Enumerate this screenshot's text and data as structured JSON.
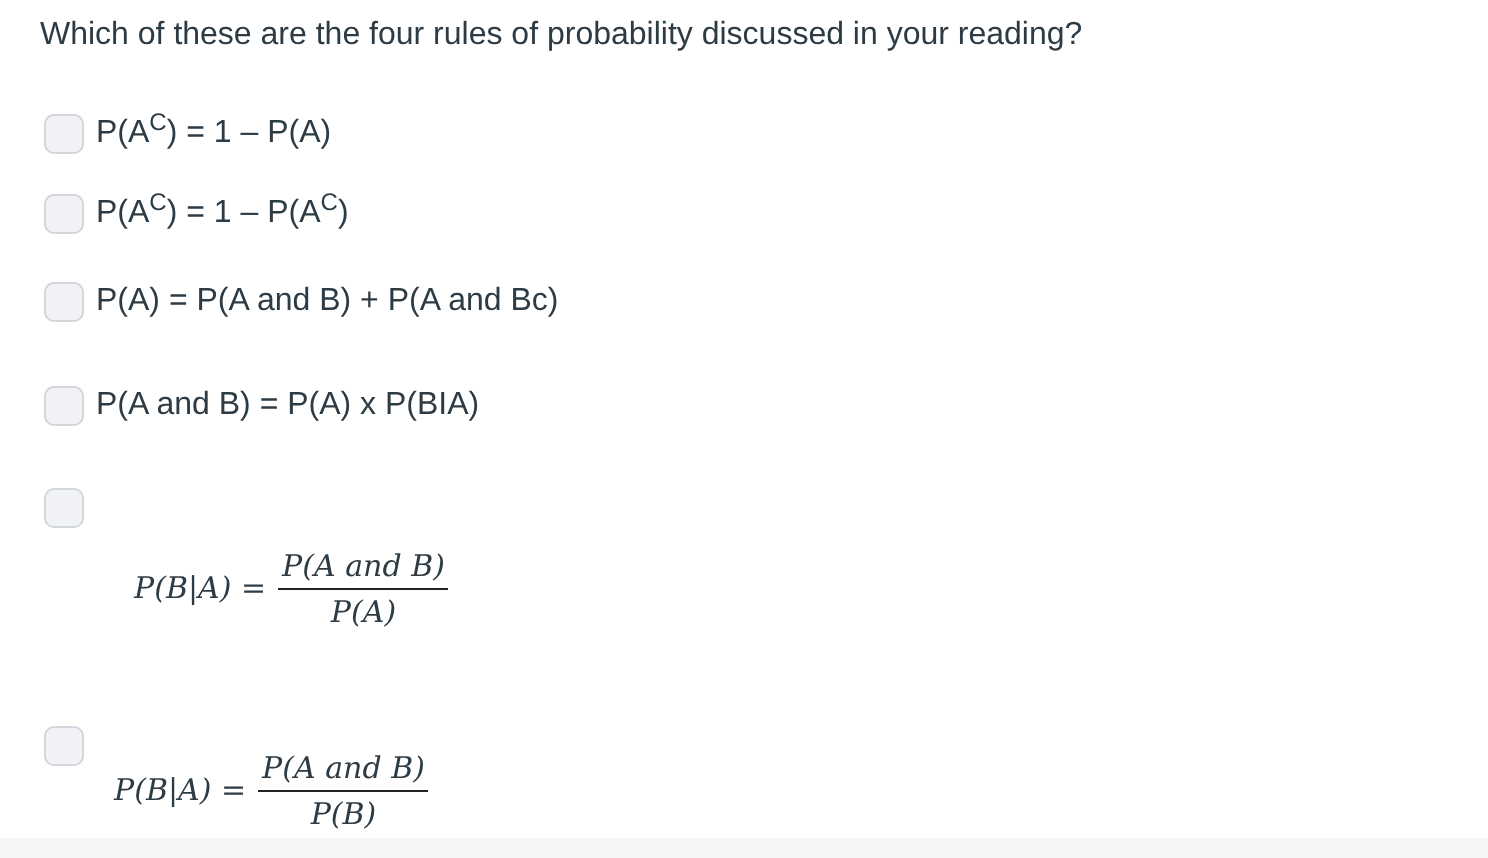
{
  "question": "Which of these are the four rules of probability discussed in your reading?",
  "options": [
    {
      "kind": "text",
      "checked": false,
      "text": "P(A$^{C}$) = 1 – P(A)"
    },
    {
      "kind": "text",
      "checked": false,
      "text": "P(A$^{C}$) = 1 – P(A$^{C}$)"
    },
    {
      "kind": "text",
      "checked": false,
      "text": "P(A) = P(A and B) + P(A and Bc)"
    },
    {
      "kind": "text",
      "checked": false,
      "text": "P(A and B) = P(A) x P(BIA)"
    },
    {
      "kind": "fraction",
      "checked": false,
      "lhs": "P(B|A) =",
      "numerator": "P(A and B)",
      "denominator": "P(A)"
    },
    {
      "kind": "fraction",
      "checked": false,
      "lhs": "P(B|A) =",
      "numerator": "P(A and B)",
      "denominator": "P(B)"
    }
  ]
}
